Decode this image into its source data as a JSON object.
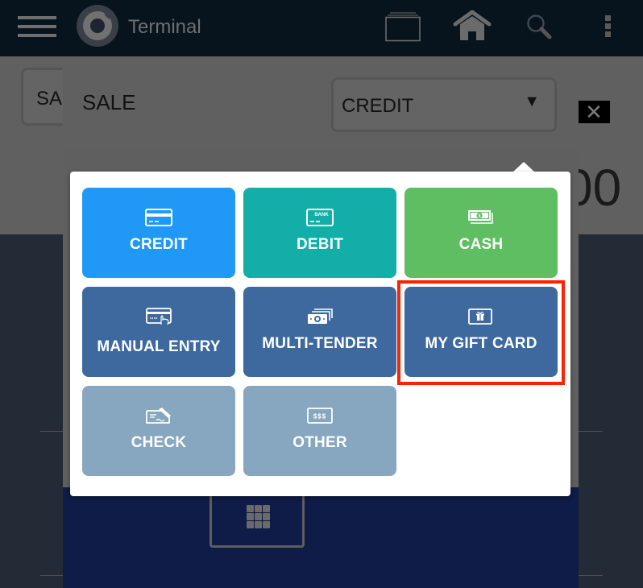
{
  "appbar": {
    "title": "Terminal",
    "icons": [
      "menu-icon",
      "app-logo",
      "tabs-icon",
      "home-icon",
      "search-icon",
      "more-vert-icon"
    ]
  },
  "background": {
    "sale_button_label": "SALE",
    "amount_fragment": "00",
    "close_label": "✕"
  },
  "sale_dialog": {
    "title": "SALE",
    "payment_type_select": {
      "value": "CREDIT",
      "arrow": "▼"
    }
  },
  "tender_menu": {
    "highlighted": "MY GIFT CARD",
    "tiles": [
      {
        "label": "CREDIT",
        "icon": "credit-card-icon",
        "color": "#2098f5"
      },
      {
        "label": "DEBIT",
        "icon": "bank-card-icon",
        "color": "#14aea8",
        "icon_text": "BANK"
      },
      {
        "label": "CASH",
        "icon": "cash-icon",
        "color": "#5fbd62"
      },
      {
        "label": "MANUAL ENTRY",
        "icon": "manual-entry-icon",
        "color": "#3d699e"
      },
      {
        "label": "MULTI-TENDER",
        "icon": "multi-tender-icon",
        "color": "#3d699e"
      },
      {
        "label": "MY GIFT CARD",
        "icon": "gift-card-icon",
        "color": "#3d699e"
      },
      {
        "label": "CHECK",
        "icon": "check-icon",
        "color": "#86a7bf"
      },
      {
        "label": "OTHER",
        "icon": "other-icon",
        "color": "#86a7bf",
        "icon_text": "$$$"
      }
    ]
  },
  "colors": {
    "highlight_border": "#ff2200",
    "appbar_bg": "#07141e",
    "navy_panel": "#0f1c48"
  }
}
